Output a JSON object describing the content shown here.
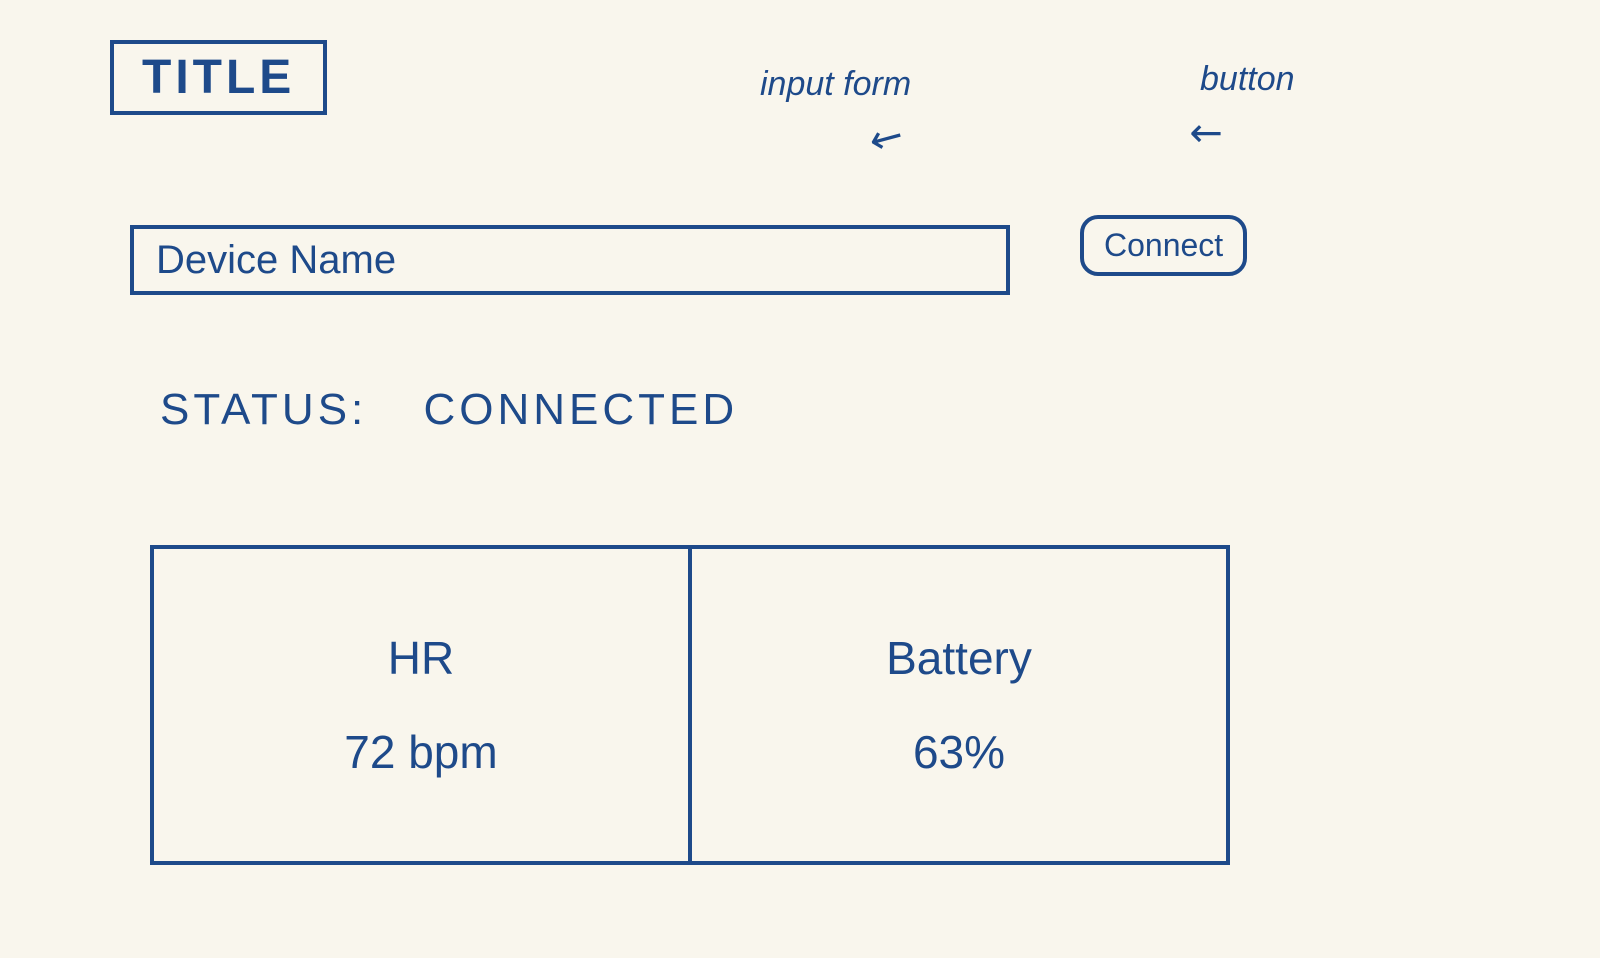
{
  "header": {
    "title": "TITLE"
  },
  "annotations": {
    "input_form": "input form",
    "button": "button"
  },
  "form": {
    "device_name_placeholder": "Device Name",
    "device_name_value": "",
    "connect_label": "Connect"
  },
  "status": {
    "label": "STATUS:",
    "value": "CONNECTED"
  },
  "metrics": {
    "hr": {
      "label": "HR",
      "value": "72 bpm"
    },
    "battery": {
      "label": "Battery",
      "value": "63%"
    }
  }
}
